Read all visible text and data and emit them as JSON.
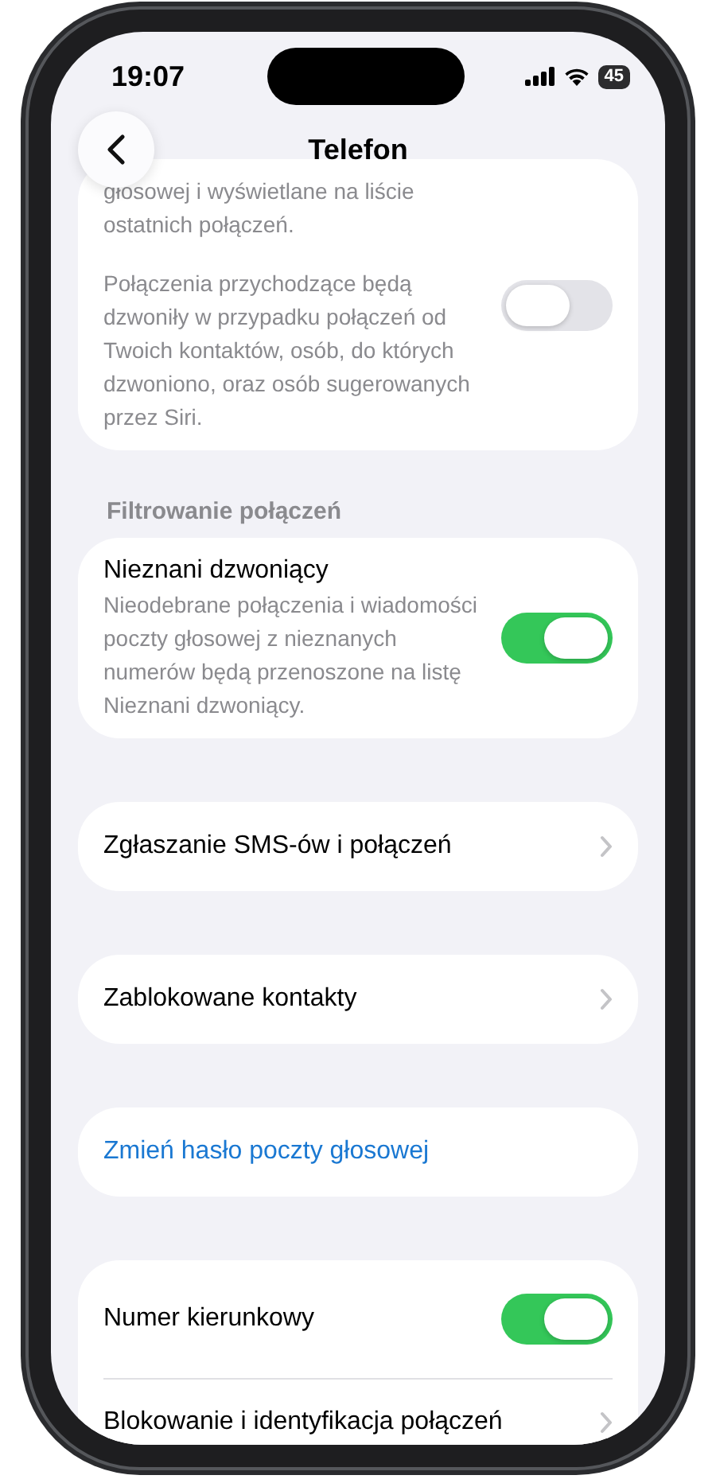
{
  "status_bar": {
    "time": "19:07",
    "battery": "45"
  },
  "nav": {
    "title": "Telefon"
  },
  "groups": [
    {
      "rows": [
        {
          "kind": "toggle",
          "descriptions": [
            "głosowej i wyświetlane na liście ostatnich połączeń.",
            "Połączenia przychodzące będą dzwoniły w przypadku połączeń od Twoich kontaktów, osób, do których dzwoniono, oraz osób sugerowanych przez Siri."
          ],
          "on": false
        }
      ]
    },
    {
      "header": "Filtrowanie połączeń",
      "rows": [
        {
          "kind": "toggle",
          "label": "Nieznani dzwoniący",
          "descriptions": [
            "Nieodebrane połączenia i wiadomości poczty głosowej z nieznanych numerów będą przenoszone na listę Nieznani dzwoniący."
          ],
          "on": true
        }
      ]
    },
    {
      "rows": [
        {
          "kind": "nav",
          "label": "Zgłaszanie SMS-ów i połączeń"
        }
      ]
    },
    {
      "rows": [
        {
          "kind": "nav",
          "label": "Zablokowane kontakty"
        }
      ]
    },
    {
      "rows": [
        {
          "kind": "link",
          "label": "Zmień hasło poczty głosowej"
        }
      ]
    },
    {
      "rows": [
        {
          "kind": "toggle",
          "label": "Numer kierunkowy",
          "on": true
        },
        {
          "kind": "nav",
          "label": "Blokowanie i identyfikacja połączeń"
        }
      ]
    }
  ]
}
